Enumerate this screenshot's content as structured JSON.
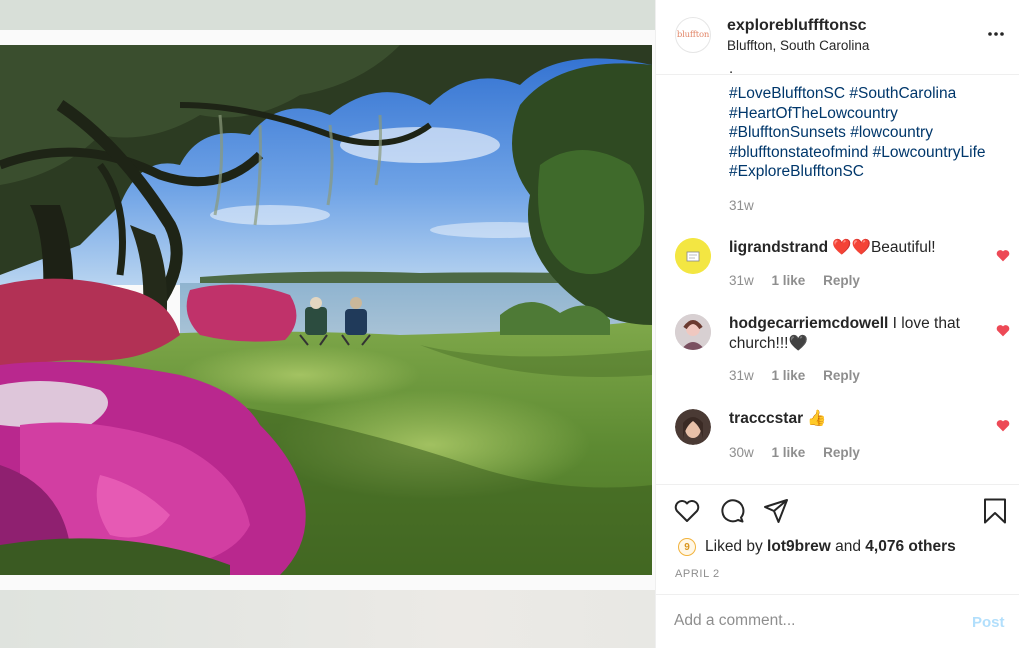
{
  "post": {
    "username": "explorebluffftonsc",
    "location": "Bluffton, South Carolina",
    "brand_logo_text": "bluffton",
    "more_icon": "more-horizontal-icon",
    "caption_partial": ".",
    "hashtags": [
      "#LoveBlufftonSC",
      "#SouthCarolina",
      "#HeartOfTheLowcountry",
      "#BlufftonSunsets",
      "#lowcountry",
      "#blufftonstateofmind",
      "#LowcountryLife",
      "#ExploreBlufftonSC"
    ],
    "caption_age": "31w"
  },
  "comments": [
    {
      "user": "ligrandstrand",
      "text": "❤️❤️Beautiful!",
      "age": "31w",
      "likes": "1 like",
      "reply": "Reply"
    },
    {
      "user": "hodgecarriemcdowell",
      "text": "I love that church!!!🖤",
      "age": "31w",
      "likes": "1 like",
      "reply": "Reply"
    },
    {
      "user": "tracccstar",
      "text": "👍",
      "age": "30w",
      "likes": "1 like",
      "reply": "Reply"
    }
  ],
  "actions": {
    "icons": [
      "heart-icon",
      "comment-icon",
      "share-icon",
      "bookmark-icon"
    ],
    "liked_prefix": "Liked by",
    "liked_user": "lot9brew",
    "liked_and": "and",
    "liked_others": "4,076 others",
    "date": "APRIL 2"
  },
  "comment_box": {
    "placeholder": "Add a comment...",
    "post_label": "Post"
  },
  "colors": {
    "link_blue": "#00376b",
    "muted": "#8e8e8e",
    "heart_red": "#ed4956",
    "post_disabled": "#b2dffc"
  }
}
